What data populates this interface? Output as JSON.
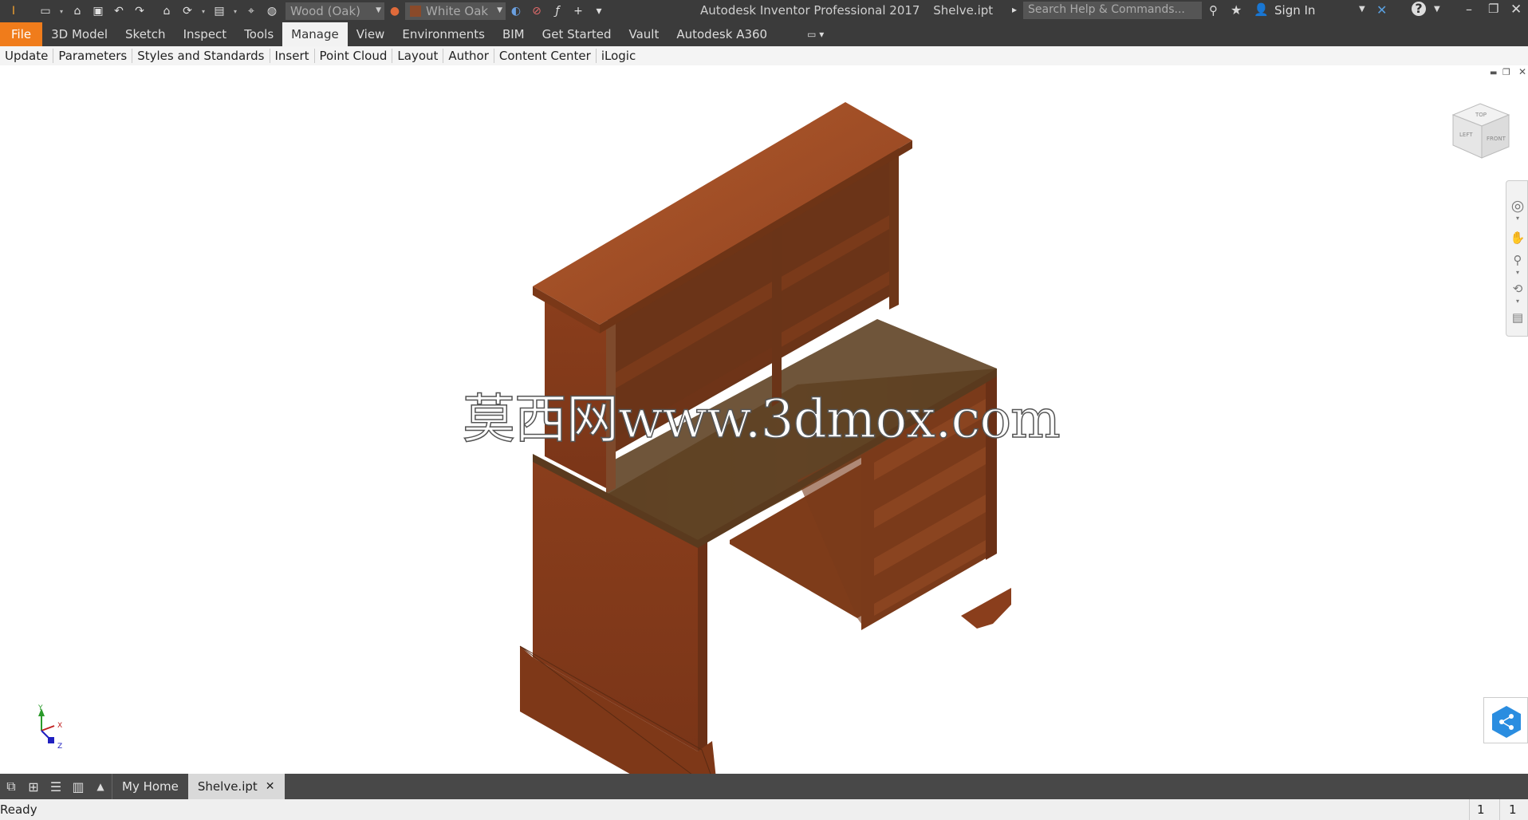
{
  "title": {
    "app": "Autodesk Inventor Professional 2017",
    "document": "Shelve.ipt"
  },
  "qat": {
    "material": "Wood (Oak)",
    "appearance": "White Oak"
  },
  "search": {
    "placeholder": "Search Help & Commands..."
  },
  "account": {
    "sign_in": "Sign In"
  },
  "ribbon": {
    "tabs": [
      "File",
      "3D Model",
      "Sketch",
      "Inspect",
      "Tools",
      "Manage",
      "View",
      "Environments",
      "BIM",
      "Get Started",
      "Vault",
      "Autodesk A360"
    ],
    "active_tab": "Manage",
    "panels": [
      "Update",
      "Parameters",
      "Styles and Standards",
      "Insert",
      "Point Cloud",
      "Layout",
      "Author",
      "Content Center",
      "iLogic"
    ]
  },
  "viewcube": {
    "top": "TOP",
    "left": "LEFT",
    "front": "FRONT"
  },
  "triad": {
    "x": "X",
    "y": "Y",
    "z": "Z"
  },
  "watermark": "莫西网www.3dmox.com",
  "doc_tabs": {
    "home": "My Home",
    "doc": "Shelve.ipt"
  },
  "status": {
    "text": "Ready",
    "count1": "1",
    "count2": "1"
  },
  "colors": {
    "accent_file": "#f07c1b",
    "chrome": "#3b3b3b",
    "wood_top": "#9c4a22",
    "wood_front": "#8a3e1c"
  }
}
